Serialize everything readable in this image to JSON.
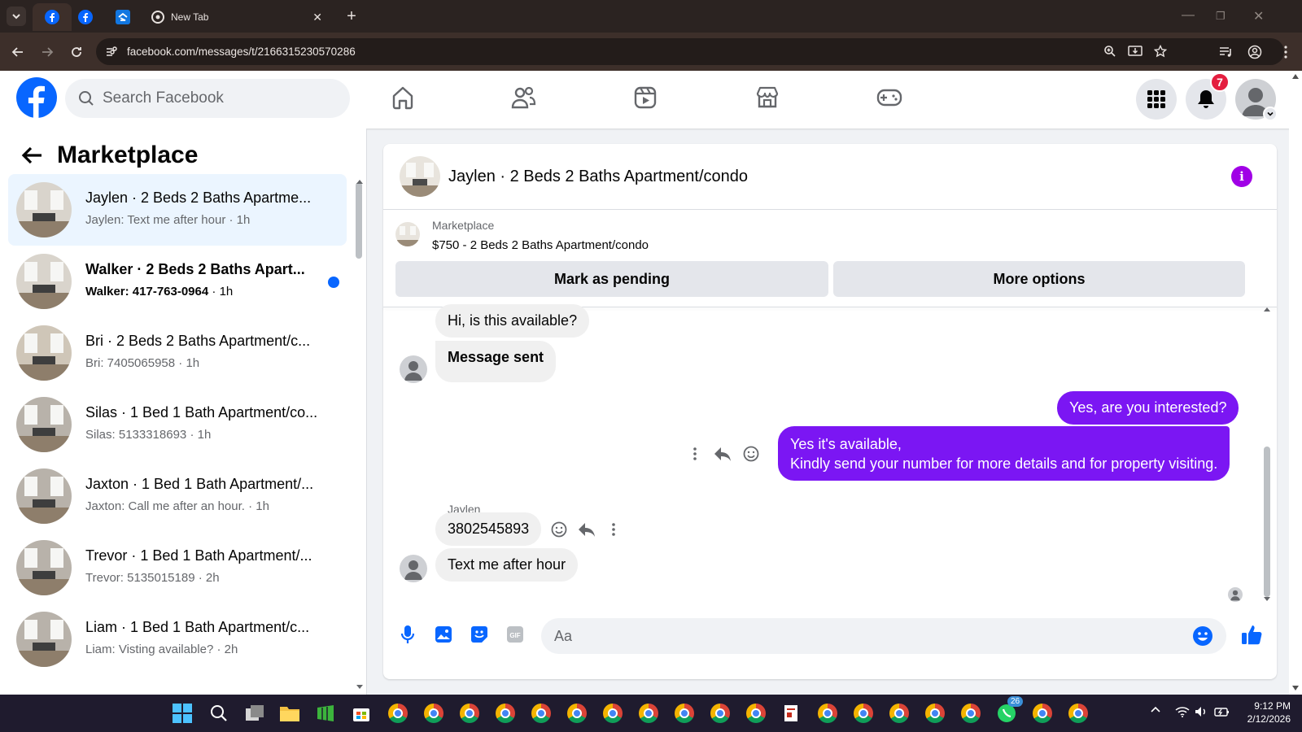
{
  "browser": {
    "tab_title": "New Tab",
    "url": "facebook.com/messages/t/2166315230570286"
  },
  "facebook": {
    "search_placeholder": "Search Facebook",
    "notification_count": "7"
  },
  "sidebar": {
    "title": "Marketplace",
    "conversations": [
      {
        "name": "Jaylen · 2 Beds 2 Baths Apartme...",
        "preview": "Jaylen: Text me after hour",
        "time": "1h",
        "active": true,
        "unread": false
      },
      {
        "name": "Walker · 2 Beds 2 Baths Apart...",
        "preview": "Walker: 417-763-0964",
        "time": "1h",
        "active": false,
        "unread": true
      },
      {
        "name": "Bri · 2 Beds 2 Baths Apartment/c...",
        "preview": "Bri: 7405065958",
        "time": "1h",
        "active": false,
        "unread": false
      },
      {
        "name": "Silas · 1 Bed 1 Bath Apartment/co...",
        "preview": "Silas: 5133318693",
        "time": "1h",
        "active": false,
        "unread": false
      },
      {
        "name": "Jaxton · 1 Bed 1 Bath Apartment/...",
        "preview": "Jaxton: Call me after an hour.",
        "time": "1h",
        "active": false,
        "unread": false
      },
      {
        "name": "Trevor · 1 Bed 1 Bath Apartment/...",
        "preview": "Trevor: 5135015189",
        "time": "2h",
        "active": false,
        "unread": false
      },
      {
        "name": "Liam · 1 Bed 1 Bath Apartment/c...",
        "preview": "Liam: Visting available?",
        "time": "2h",
        "active": false,
        "unread": false
      }
    ]
  },
  "chat": {
    "title": "Jaylen · 2 Beds 2 Baths Apartment/condo",
    "listing_source": "Marketplace",
    "listing": "$750 - 2 Beds 2 Baths Apartment/condo",
    "mark_pending_label": "Mark as pending",
    "more_options_label": "More options",
    "messages": [
      {
        "from": "them",
        "text": "Hi, is this available?"
      },
      {
        "from": "them",
        "text": "Message sent"
      },
      {
        "from": "me",
        "text": "Yes, are you interested?"
      },
      {
        "from": "me",
        "text": "Yes it's available,"
      },
      {
        "from": "me",
        "text": "Kindly send your number for more details and for property visiting."
      },
      {
        "from": "them",
        "text": "3802545893"
      },
      {
        "from": "them",
        "text": "Text me after hour"
      }
    ],
    "sender_label": "Jaylen",
    "composer_placeholder": "Aa"
  },
  "taskbar": {
    "time": "9:12 PM",
    "date": "2/12/2026",
    "whatsapp_badge": "26"
  },
  "colors": {
    "facebook_blue": "#0866ff",
    "outgoing_bubble": "#7b16f3",
    "notification_red": "#e41e3f"
  }
}
